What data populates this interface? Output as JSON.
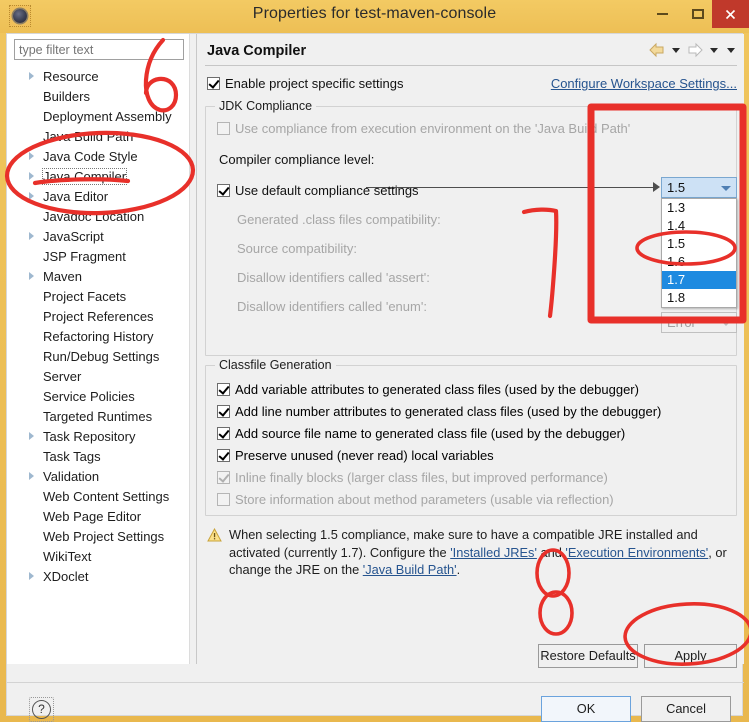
{
  "window": {
    "title": "Properties for test-maven-console",
    "app_icon": "eclipse-icon",
    "minimize": "–",
    "maximize": "□",
    "close": "✕"
  },
  "sidebar": {
    "filter_placeholder": "type filter text",
    "filter_value": "",
    "selected": "Java Compiler",
    "items": [
      {
        "label": "Resource",
        "expandable": true
      },
      {
        "label": "Builders",
        "expandable": false
      },
      {
        "label": "Deployment Assembly",
        "expandable": false
      },
      {
        "label": "Java Build Path",
        "expandable": false
      },
      {
        "label": "Java Code Style",
        "expandable": true
      },
      {
        "label": "Java Compiler",
        "expandable": true
      },
      {
        "label": "Java Editor",
        "expandable": true
      },
      {
        "label": "Javadoc Location",
        "expandable": false
      },
      {
        "label": "JavaScript",
        "expandable": true
      },
      {
        "label": "JSP Fragment",
        "expandable": false
      },
      {
        "label": "Maven",
        "expandable": true
      },
      {
        "label": "Project Facets",
        "expandable": false
      },
      {
        "label": "Project References",
        "expandable": false
      },
      {
        "label": "Refactoring History",
        "expandable": false
      },
      {
        "label": "Run/Debug Settings",
        "expandable": false
      },
      {
        "label": "Server",
        "expandable": false
      },
      {
        "label": "Service Policies",
        "expandable": false
      },
      {
        "label": "Targeted Runtimes",
        "expandable": false
      },
      {
        "label": "Task Repository",
        "expandable": true
      },
      {
        "label": "Task Tags",
        "expandable": false
      },
      {
        "label": "Validation",
        "expandable": true
      },
      {
        "label": "Web Content Settings",
        "expandable": false
      },
      {
        "label": "Web Page Editor",
        "expandable": false
      },
      {
        "label": "Web Project Settings",
        "expandable": false
      },
      {
        "label": "WikiText",
        "expandable": false
      },
      {
        "label": "XDoclet",
        "expandable": true
      }
    ]
  },
  "page": {
    "title": "Java Compiler",
    "nav": {
      "back": "back-arrow-icon",
      "back_menu": "chevron-down-icon",
      "forward": "forward-arrow-icon",
      "forward_menu": "chevron-down-icon",
      "view_menu": "chevron-down-icon"
    },
    "enable_project_specific": "Enable project specific settings",
    "enable_project_specific_checked": true,
    "configure_workspace_link": "Configure Workspace Settings..."
  },
  "jdk_compliance": {
    "group_title": "JDK Compliance",
    "use_execution_env": "Use compliance from execution environment on the 'Java Build Path'",
    "use_execution_env_checked": false,
    "use_execution_env_link": "Java Build Path",
    "compliance_level_label": "Compiler compliance level:",
    "compliance_level_value": "1.5",
    "compliance_level_options": [
      "1.3",
      "1.4",
      "1.5",
      "1.6",
      "1.7",
      "1.8"
    ],
    "compliance_level_highlighted": "1.7",
    "use_default_settings": "Use default compliance settings",
    "use_default_settings_checked": true,
    "disabled_rows": [
      "Generated .class files compatibility:",
      "Source compatibility:",
      "Disallow identifiers called 'assert':",
      "Disallow identifiers called 'enum':"
    ],
    "severity_value": "Error"
  },
  "classfile_generation": {
    "group_title": "Classfile Generation",
    "options": [
      {
        "label": "Add variable attributes to generated class files (used by the debugger)",
        "checked": true,
        "enabled": true
      },
      {
        "label": "Add line number attributes to generated class files (used by the debugger)",
        "checked": true,
        "enabled": true
      },
      {
        "label": "Add source file name to generated class file (used by the debugger)",
        "checked": true,
        "enabled": true
      },
      {
        "label": "Preserve unused (never read) local variables",
        "checked": true,
        "enabled": true
      },
      {
        "label": "Inline finally blocks (larger class files, but improved performance)",
        "checked": true,
        "enabled": false
      },
      {
        "label": "Store information about method parameters (usable via reflection)",
        "checked": false,
        "enabled": false
      }
    ]
  },
  "warning": {
    "icon": "warning-triangle-icon",
    "text_1": "When selecting 1.5 compliance, make sure to have a compatible JRE installed and activated (currently 1.7). Configure the ",
    "link_1": "'Installed JREs'",
    "text_2": " and ",
    "link_2": "'Execution Environments'",
    "text_3": ", or change the JRE on the ",
    "link_3": "'Java Build Path'",
    "text_4": "."
  },
  "buttons": {
    "restore_defaults": "Restore Defaults",
    "apply": "Apply",
    "ok": "OK",
    "cancel": "Cancel",
    "help": "?"
  },
  "annotations": {
    "color": "#e8302a",
    "marks": [
      {
        "name": "digit-6",
        "kind": "handwritten-digit",
        "value": "6"
      },
      {
        "name": "ellipse-java-compiler",
        "kind": "ellipse"
      },
      {
        "name": "underline-java-compiler",
        "kind": "underline"
      },
      {
        "name": "digit-7",
        "kind": "handwritten-digit",
        "value": "7"
      },
      {
        "name": "rect-compliance-level",
        "kind": "rectangle"
      },
      {
        "name": "ellipse-option-1-7",
        "kind": "ellipse"
      },
      {
        "name": "digit-8",
        "kind": "handwritten-digit",
        "value": "8"
      },
      {
        "name": "ellipse-apply-button",
        "kind": "ellipse"
      }
    ]
  }
}
